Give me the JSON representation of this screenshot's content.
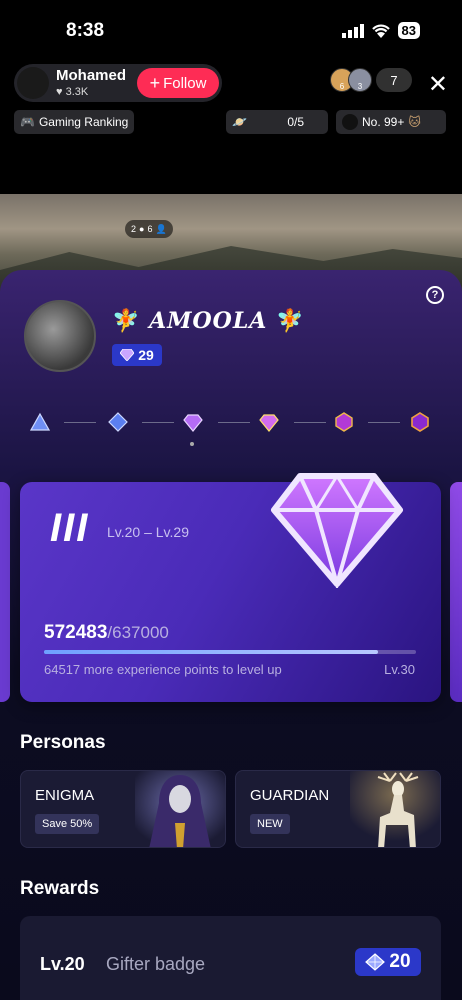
{
  "status_bar": {
    "time": "8:38",
    "battery": "83"
  },
  "host": {
    "name": "Mohamed",
    "likes": "3.3K",
    "follow_label": "Follow"
  },
  "viewers": {
    "avatar_a_level": "6",
    "avatar_b_level": "3",
    "count": "7"
  },
  "chips": {
    "gaming_ranking": "Gaming Ranking",
    "quest_progress": "0/5",
    "rank": "No. 99+"
  },
  "stream_stats": {
    "a": "2",
    "b": "6"
  },
  "profile": {
    "name": "AMOOLA",
    "badge_level": "29"
  },
  "level_card": {
    "tier_numeral": "III",
    "range": "Lv.20 – Lv.29",
    "xp_current": "572483",
    "xp_total": "/637000",
    "progress": 0.899,
    "hint": "64517 more experience points to level up",
    "next_level": "Lv.30"
  },
  "personas": {
    "title": "Personas",
    "items": [
      {
        "name": "ENIGMA",
        "tag": "Save 50%"
      },
      {
        "name": "GUARDIAN",
        "tag": "NEW"
      }
    ]
  },
  "rewards": {
    "title": "Rewards",
    "items": [
      {
        "level": "Lv.20",
        "name": "Gifter badge",
        "badge_value": "20"
      }
    ]
  },
  "colors": {
    "follow": "#fe2c55",
    "badge": "#2b38c9",
    "panel": "#1a1442"
  }
}
